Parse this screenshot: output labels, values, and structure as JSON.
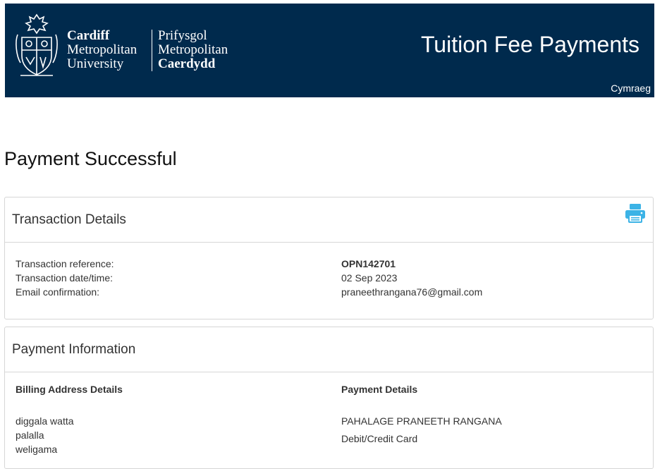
{
  "header": {
    "logo_en_lines": [
      "Cardiff",
      "Metropolitan",
      "University"
    ],
    "logo_cy_lines": [
      "Prifysgol",
      "Metropolitan",
      "Caerdydd"
    ],
    "site_title": "Tuition Fee Payments",
    "language_link": "Cymraeg"
  },
  "page_title": "Payment Successful",
  "transaction": {
    "heading": "Transaction Details",
    "print_icon": "printer-icon",
    "rows": [
      {
        "label": "Transaction reference:",
        "value": "OPN142701"
      },
      {
        "label": "Transaction date/time:",
        "value": "02 Sep 2023"
      },
      {
        "label": "Email confirmation:",
        "value": "praneethrangana76@gmail.com"
      }
    ]
  },
  "payment": {
    "heading": "Payment Information",
    "billing_heading": "Billing Address Details",
    "billing_lines": [
      "diggala watta",
      "palalla",
      "weligama"
    ],
    "payment_heading": "Payment Details",
    "payment_lines": [
      "PAHALAGE PRANEETH RANGANA",
      "Debit/Credit Card"
    ]
  },
  "colors": {
    "header_bg": "#002a4d",
    "accent_icon": "#3cb3e6",
    "panel_border": "#d6d6d6"
  }
}
